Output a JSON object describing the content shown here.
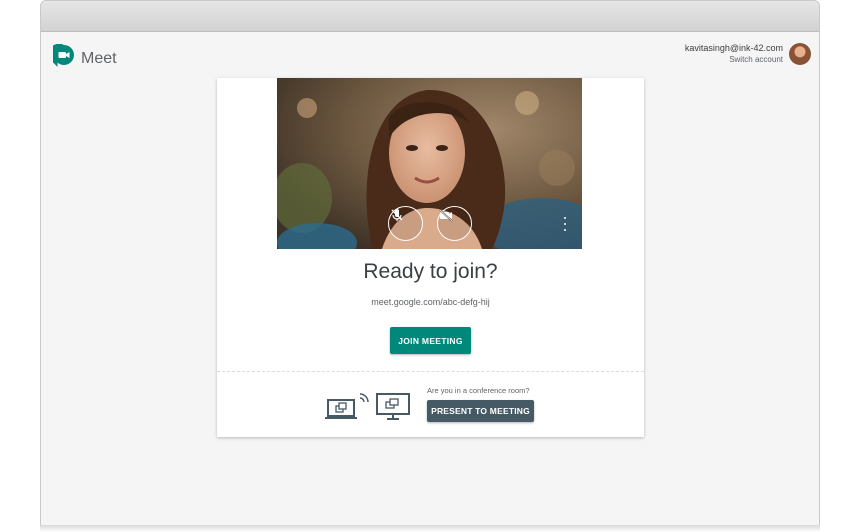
{
  "app": {
    "name": "Meet",
    "logo_icon": "meet-camera-bubble-icon",
    "brand_color": "#00897b"
  },
  "account": {
    "email": "kavitasingh@ink-42.com",
    "switch_label": "Switch account"
  },
  "preview": {
    "mic_icon": "mic-off-icon",
    "camera_icon": "camera-off-icon",
    "more_icon": "more-vert-icon"
  },
  "join": {
    "title": "Ready to join?",
    "meeting_url": "meet.google.com/abc-defg-hij",
    "join_label": "JOIN MEETING"
  },
  "conference": {
    "question": "Are you in a conference room?",
    "present_label": "PRESENT TO MEETING",
    "present_color": "#455a64"
  }
}
